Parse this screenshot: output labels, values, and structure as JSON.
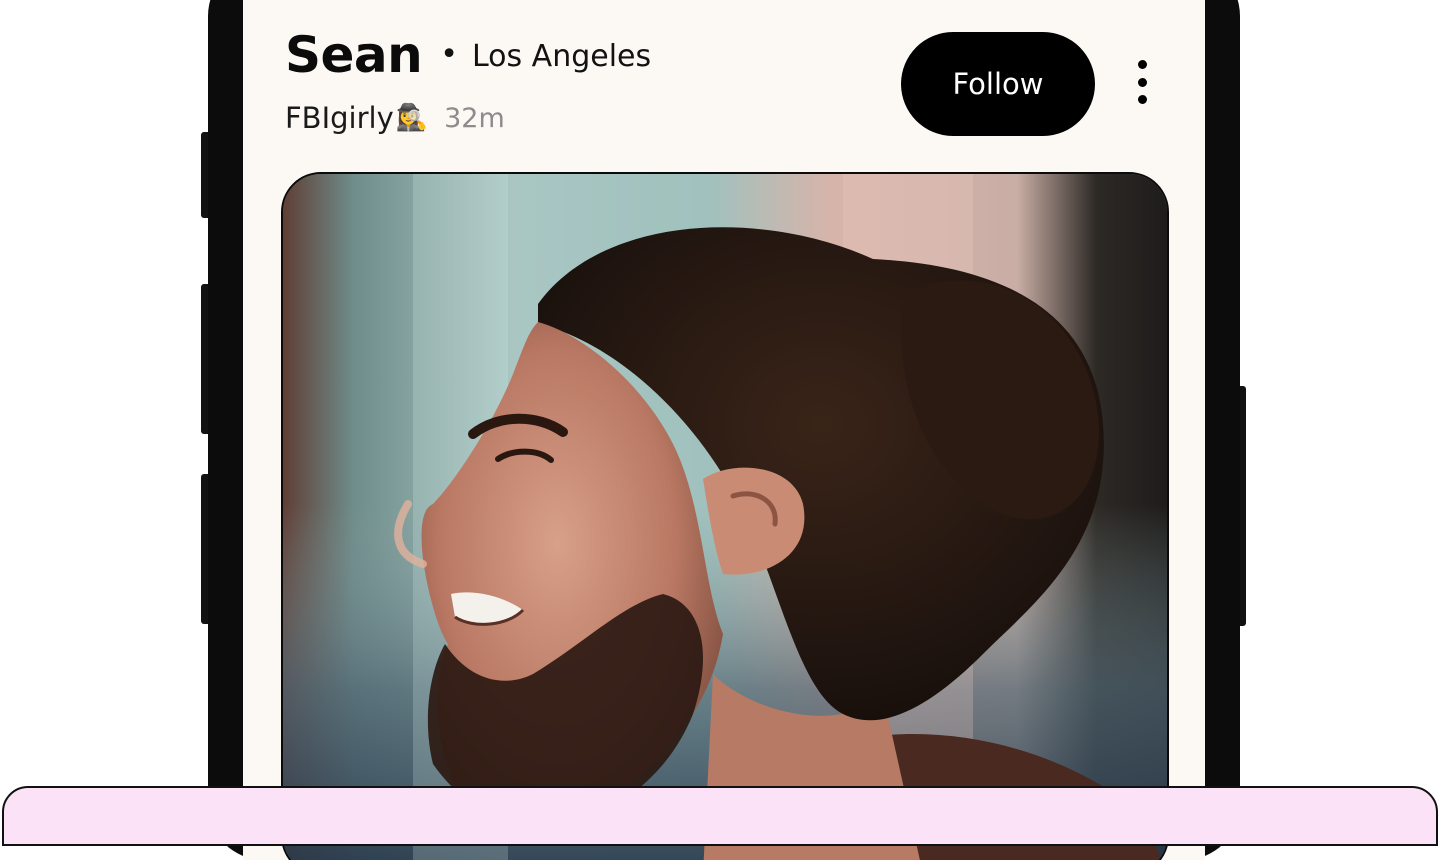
{
  "profile": {
    "name": "Sean",
    "separator": "•",
    "location": "Los Angeles",
    "username": "FBIgirly",
    "username_emoji": "🕵️‍♀️",
    "time_ago": "32m"
  },
  "actions": {
    "follow_label": "Follow",
    "more_icon": "vertical-ellipsis-icon"
  },
  "photo": {
    "subject": "profile-photo"
  },
  "colors": {
    "screen_background": "#fcf9f5",
    "follow_background": "#000000",
    "follow_text": "#ffffff",
    "sheet_background": "#fbe2f6",
    "time_text": "#8c8c8c"
  }
}
